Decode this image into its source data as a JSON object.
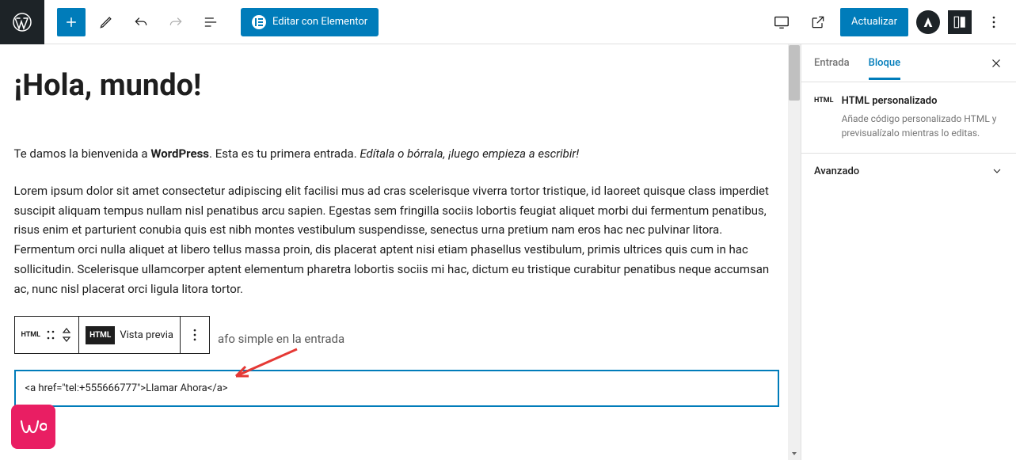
{
  "toolbar": {
    "elementor_label": "Editar con Elementor",
    "update_label": "Actualizar"
  },
  "editor": {
    "title": "¡Hola, mundo!",
    "welcome_prefix": "Te damos la bienvenida a ",
    "welcome_bold": "WordPress",
    "welcome_mid": ". Esta es tu primera entrada. ",
    "welcome_em": "Edítala o bórrala, ¡luego empieza a escribir!",
    "lorem": "Lorem ipsum dolor sit amet consectetur adipiscing elit facilisi mus ad cras scelerisque viverra tortor tristique, id laoreet quisque class imperdiet suscipit aliquam tempus nullam nisl penatibus arcu sapien. Egestas sem fringilla sociis lobortis feugiat aliquet morbi dui fermentum penatibus, risus enim et parturient conubia quis est nibh montes vestibulum suspendisse, senectus urna pretium nam eros hac nec pulvinar litora. Fermentum orci nulla aliquet at libero tellus massa proin, dis placerat aptent nisi etiam phasellus vestibulum, primis ultrices quis cum in hac sollicitudin. Scelerisque ullamcorper aptent elementum pharetra lobortis sociis mi hac, dictum eu tristique curabitur penatibus neque accumsan ac, nunc nisl placerat orci ligula litora tortor.",
    "block_toolbar": {
      "html_small": "HTML",
      "html_badge": "HTML",
      "preview_label": "Vista previa"
    },
    "inline_fragment": "afo simple en la entrada",
    "code_content": "<a href=\"tel:+555666777\">Llamar Ahora</a>"
  },
  "sidebar": {
    "tab_entry": "Entrada",
    "tab_block": "Bloque",
    "block_badge": "HTML",
    "block_title": "HTML personalizado",
    "block_desc": "Añade código personalizado HTML y previsualízalo mientras lo editas.",
    "panel_advanced": "Avanzado"
  }
}
